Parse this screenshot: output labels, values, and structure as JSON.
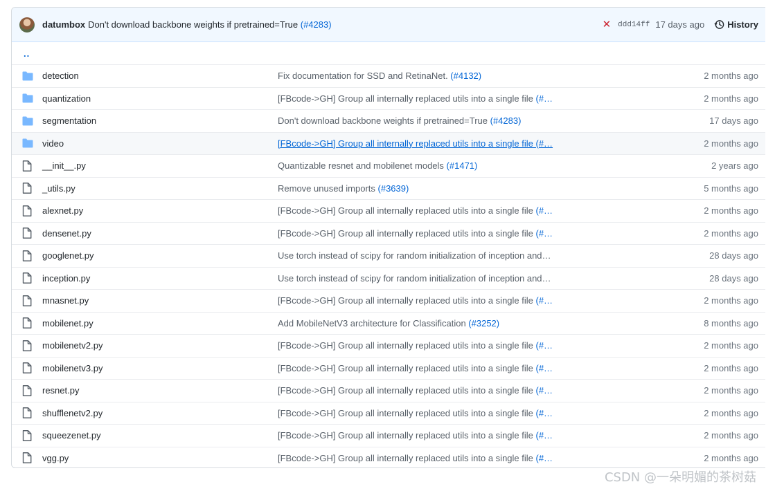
{
  "latest_commit": {
    "author": "datumbox",
    "message": "Don't download backbone weights if pretrained=True",
    "pr": "(#4283)",
    "status_icon": "x-icon",
    "status_color": "#cb2431",
    "sha": "ddd14ff",
    "age": "17 days ago",
    "history_label": "History"
  },
  "parent_dir": "..",
  "rows": [
    {
      "type": "dir",
      "name": "detection",
      "msg": "Fix documentation for SSD and RetinaNet. ",
      "pr": "(#4132)",
      "age": "2 months ago"
    },
    {
      "type": "dir",
      "name": "quantization",
      "msg": "[FBcode->GH] Group all internally replaced utils into a single file ",
      "pr": "(#…",
      "age": "2 months ago"
    },
    {
      "type": "dir",
      "name": "segmentation",
      "msg": "Don't download backbone weights if pretrained=True ",
      "pr": "(#4283)",
      "age": "17 days ago"
    },
    {
      "type": "dir",
      "name": "video",
      "msg": "[FBcode->GH] Group all internally replaced utils into a single file (#…",
      "pr": "",
      "age": "2 months ago",
      "hover": true
    },
    {
      "type": "file",
      "name": "__init__.py",
      "msg": "Quantizable resnet and mobilenet models ",
      "pr": "(#1471)",
      "age": "2 years ago"
    },
    {
      "type": "file",
      "name": "_utils.py",
      "msg": "Remove unused imports ",
      "pr": "(#3639)",
      "age": "5 months ago"
    },
    {
      "type": "file",
      "name": "alexnet.py",
      "msg": "[FBcode->GH] Group all internally replaced utils into a single file ",
      "pr": "(#…",
      "age": "2 months ago"
    },
    {
      "type": "file",
      "name": "densenet.py",
      "msg": "[FBcode->GH] Group all internally replaced utils into a single file ",
      "pr": "(#…",
      "age": "2 months ago"
    },
    {
      "type": "file",
      "name": "googlenet.py",
      "msg": "Use torch instead of scipy for random initialization of inception and…",
      "pr": "",
      "age": "28 days ago"
    },
    {
      "type": "file",
      "name": "inception.py",
      "msg": "Use torch instead of scipy for random initialization of inception and…",
      "pr": "",
      "age": "28 days ago"
    },
    {
      "type": "file",
      "name": "mnasnet.py",
      "msg": "[FBcode->GH] Group all internally replaced utils into a single file ",
      "pr": "(#…",
      "age": "2 months ago"
    },
    {
      "type": "file",
      "name": "mobilenet.py",
      "msg": "Add MobileNetV3 architecture for Classification ",
      "pr": "(#3252)",
      "age": "8 months ago"
    },
    {
      "type": "file",
      "name": "mobilenetv2.py",
      "msg": "[FBcode->GH] Group all internally replaced utils into a single file ",
      "pr": "(#…",
      "age": "2 months ago"
    },
    {
      "type": "file",
      "name": "mobilenetv3.py",
      "msg": "[FBcode->GH] Group all internally replaced utils into a single file ",
      "pr": "(#…",
      "age": "2 months ago"
    },
    {
      "type": "file",
      "name": "resnet.py",
      "msg": "[FBcode->GH] Group all internally replaced utils into a single file ",
      "pr": "(#…",
      "age": "2 months ago"
    },
    {
      "type": "file",
      "name": "shufflenetv2.py",
      "msg": "[FBcode->GH] Group all internally replaced utils into a single file ",
      "pr": "(#…",
      "age": "2 months ago"
    },
    {
      "type": "file",
      "name": "squeezenet.py",
      "msg": "[FBcode->GH] Group all internally replaced utils into a single file ",
      "pr": "(#…",
      "age": "2 months ago"
    },
    {
      "type": "file",
      "name": "vgg.py",
      "msg": "[FBcode->GH] Group all internally replaced utils into a single file ",
      "pr": "(#…",
      "age": "2 months ago"
    }
  ],
  "icons": {
    "dir": "folder-icon",
    "file": "file-icon"
  },
  "colors": {
    "folder": "#79b8ff",
    "link": "#0366d6"
  },
  "watermark": "CSDN @一朵明媚的茶树菇"
}
